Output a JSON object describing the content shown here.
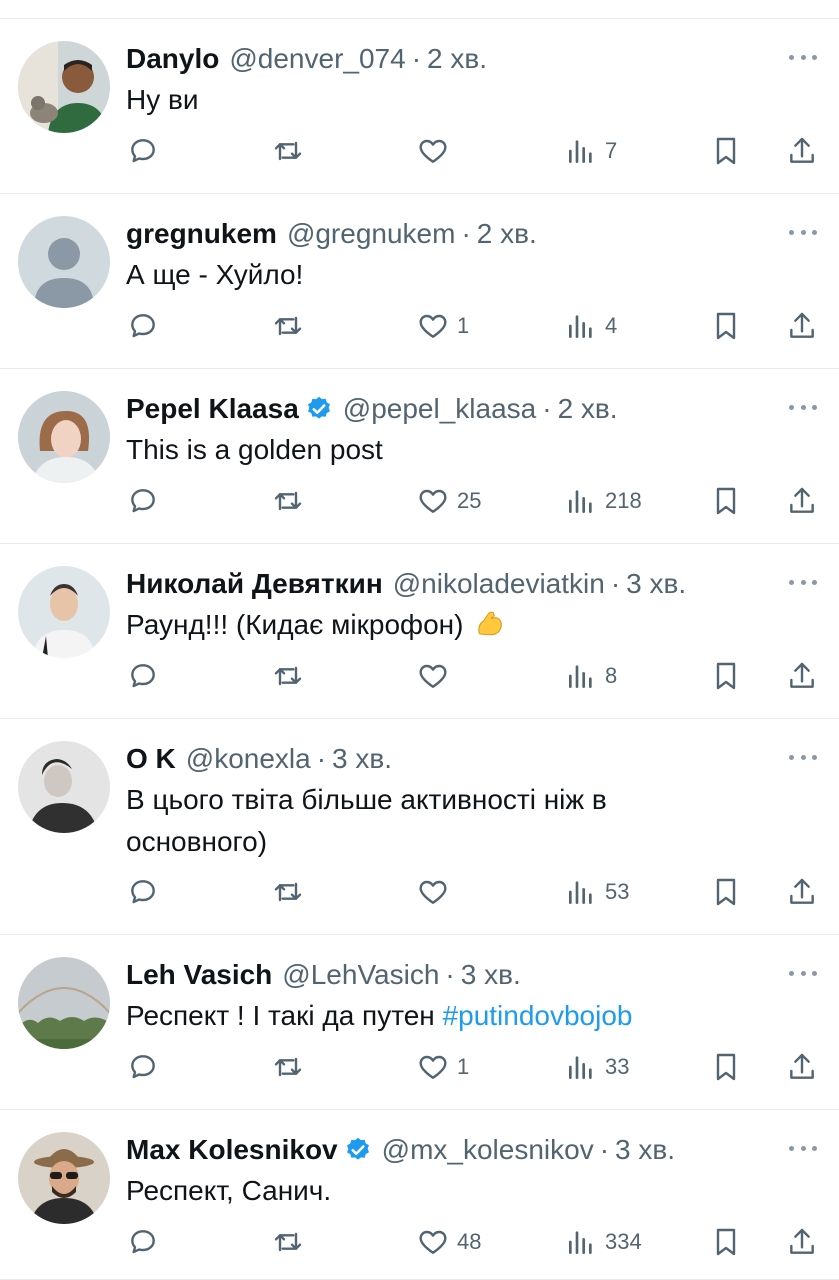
{
  "tweets": [
    {
      "name": "Danylo",
      "verified": false,
      "handle": "@denver_074",
      "time": "2 хв.",
      "text": "Ну ви",
      "hashtag": "",
      "emoji": "",
      "replies": "",
      "retweets": "",
      "likes": "",
      "views": "7"
    },
    {
      "name": "gregnukem",
      "verified": false,
      "handle": "@gregnukem",
      "time": "2 хв.",
      "text": "А ще - Хуйло!",
      "hashtag": "",
      "emoji": "",
      "replies": "",
      "retweets": "",
      "likes": "1",
      "views": "4"
    },
    {
      "name": "Pepel Klaasa",
      "verified": true,
      "handle": "@pepel_klaasa",
      "time": "2 хв.",
      "text": "This is a golden post",
      "hashtag": "",
      "emoji": "",
      "replies": "",
      "retweets": "",
      "likes": "25",
      "views": "218"
    },
    {
      "name": "Николай Девяткин",
      "verified": false,
      "handle": "@nikoladeviatkin",
      "time": "3 хв.",
      "text": "Раунд!!! (Кидає мікрофон)",
      "hashtag": "",
      "emoji": "flexed-biceps",
      "replies": "",
      "retweets": "",
      "likes": "",
      "views": "8"
    },
    {
      "name": "O K",
      "verified": false,
      "handle": "@konexla",
      "time": "3 хв.",
      "text": "В цього твіта більше активності ніж в основного)",
      "hashtag": "",
      "emoji": "",
      "replies": "",
      "retweets": "",
      "likes": "",
      "views": "53"
    },
    {
      "name": "Leh Vasich",
      "verified": false,
      "handle": "@LehVasich",
      "time": "3 хв.",
      "text": "Респект ! І такі да путен ",
      "hashtag": "#putindovbojob",
      "emoji": "",
      "replies": "",
      "retweets": "",
      "likes": "1",
      "views": "33"
    },
    {
      "name": "Max Kolesnikov",
      "verified": true,
      "handle": "@mx_kolesnikov",
      "time": "3 хв.",
      "text": "Респект, Санич.",
      "hashtag": "",
      "emoji": "",
      "replies": "",
      "retweets": "",
      "likes": "48",
      "views": "334"
    }
  ],
  "icons": {
    "reply": "reply-icon",
    "retweet": "retweet-icon",
    "like": "heart-icon",
    "views": "views-icon",
    "bookmark": "bookmark-icon",
    "share": "share-icon",
    "more": "more-icon",
    "verified": "verified-badge-icon"
  },
  "colors": {
    "text": "#0f1419",
    "secondary": "#536471",
    "icon": "#536471",
    "accent": "#1d9bf0",
    "divider": "#e6ecf0"
  }
}
